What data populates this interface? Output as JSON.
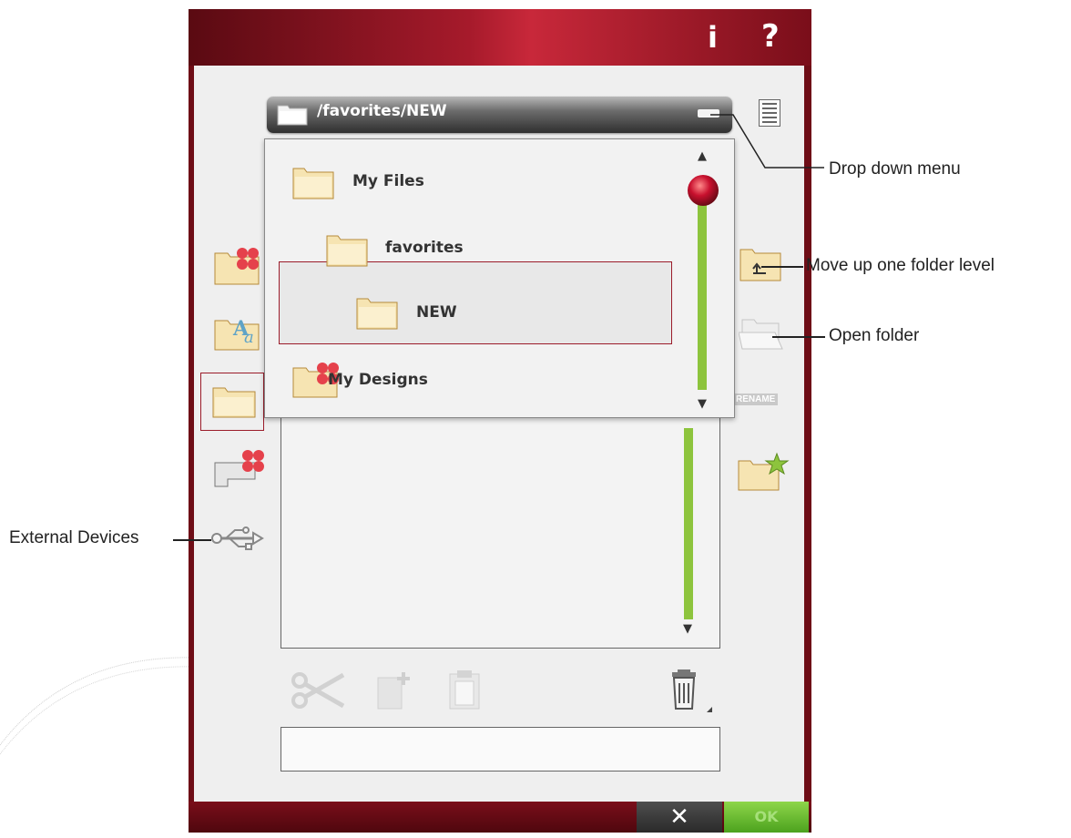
{
  "toolbar": {
    "info_glyph": "i",
    "help_glyph": "?"
  },
  "path_bar": {
    "path": "/favorites/NEW",
    "folder_icon": "folder-icon",
    "dropdown_icon": "dropdown-icon"
  },
  "side_list_icon": "list-view-icon",
  "dropdown_menu": {
    "items": [
      {
        "label": "My Files",
        "icon": "folder-icon"
      },
      {
        "label": "favorites",
        "icon": "folder-icon"
      },
      {
        "label": "NEW",
        "icon": "folder-icon",
        "selected": true
      },
      {
        "label": "My Designs",
        "icon": "designs-folder-icon"
      }
    ]
  },
  "left_icons": [
    "designs-folder-icon",
    "fonts-folder-icon",
    "personal-files-folder-icon",
    "embroidery-machine-icon",
    "usb-icon"
  ],
  "right_icons": [
    "folder-up-icon",
    "open-folder-icon",
    "rename-icon",
    "favorite-folder-icon"
  ],
  "rename_label": "RENAME",
  "edit_icons": [
    "scissors-icon",
    "new-folder-icon",
    "paste-icon",
    "trash-icon"
  ],
  "bottom_buttons": {
    "cancel": "✕",
    "ok": "OK"
  },
  "callouts": {
    "drop_down": "Drop down menu",
    "move_up": "Move up one folder level",
    "open_folder": "Open folder",
    "external": "External Devices"
  },
  "colors": {
    "accent_red": "#9b1c2a",
    "scroll_green": "#8dc43d",
    "ok_green": "#5fb82a",
    "header_red": "#b01f2f"
  }
}
